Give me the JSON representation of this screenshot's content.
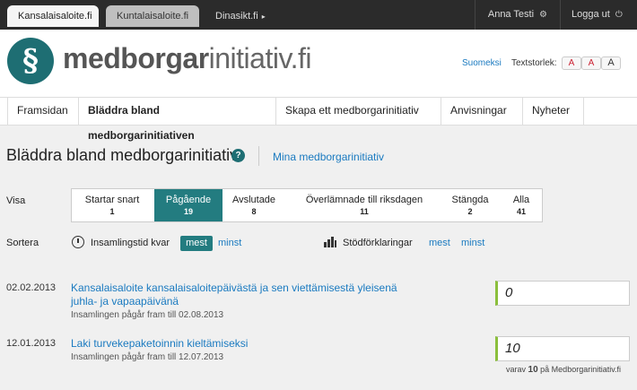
{
  "topbar": {
    "tabs": [
      {
        "label": "Kansalaisaloite.fi"
      },
      {
        "label": "Kuntalaisaloite.fi"
      }
    ],
    "extra_link": "Dinasikt.fi",
    "user": "Anna Testi",
    "logout": "Logga ut"
  },
  "header": {
    "logo_symbol": "§",
    "logo_bold": "medborgar",
    "logo_light": "initiativ.fi",
    "language": "Suomeksi",
    "textsize_label": "Textstorlek:",
    "textsize_buttons": [
      "A",
      "A",
      "A"
    ]
  },
  "nav": {
    "items": [
      {
        "label": "Framsidan"
      },
      {
        "label": "Bläddra bland medborgarinitiativen"
      },
      {
        "label": "Skapa ett medborgarinitiativ"
      },
      {
        "label": "Anvisningar"
      },
      {
        "label": "Nyheter"
      }
    ]
  },
  "page": {
    "title": "Bläddra bland medborgarinitiativ",
    "help": "?",
    "my_link": "Mina medborgarinitiativ"
  },
  "filters": {
    "label": "Visa",
    "items": [
      {
        "label": "Startar snart",
        "count": "1"
      },
      {
        "label": "Pågående",
        "count": "19"
      },
      {
        "label": "Avslutade",
        "count": "8"
      },
      {
        "label": "Överlämnade till riksdagen",
        "count": "11"
      },
      {
        "label": "Stängda",
        "count": "2"
      },
      {
        "label": "Alla",
        "count": "41"
      }
    ],
    "active_index": 1
  },
  "sort": {
    "label": "Sortera",
    "group1_label": "Insamlingstid kvar",
    "group1_active": "mest",
    "group1_link": "minst",
    "group2_label": "Stödförklaringar",
    "group2_link1": "mest",
    "group2_link2": "minst"
  },
  "initiatives": [
    {
      "date": "02.02.2013",
      "title": "Kansalaisaloite kansalaisaloitepäivästä ja sen viettämisestä yleisenä juhla- ja vapaapäivänä",
      "subtitle": "Insamlingen pågår fram till 02.08.2013",
      "count": "0"
    },
    {
      "date": "12.01.2013",
      "title": "Laki turvekepaketoinnin kieltämiseksi",
      "subtitle": "Insamlingen pågår fram till 12.07.2013",
      "count": "10"
    }
  ],
  "footer_note": {
    "prefix": "varav",
    "value": "10",
    "suffix": "på Medborgarinitiativ.fi"
  },
  "colors": {
    "accent": "#237c80",
    "link": "#1a7ac0",
    "topbar": "#2b2b2b",
    "count_border": "#8bbf3c"
  }
}
